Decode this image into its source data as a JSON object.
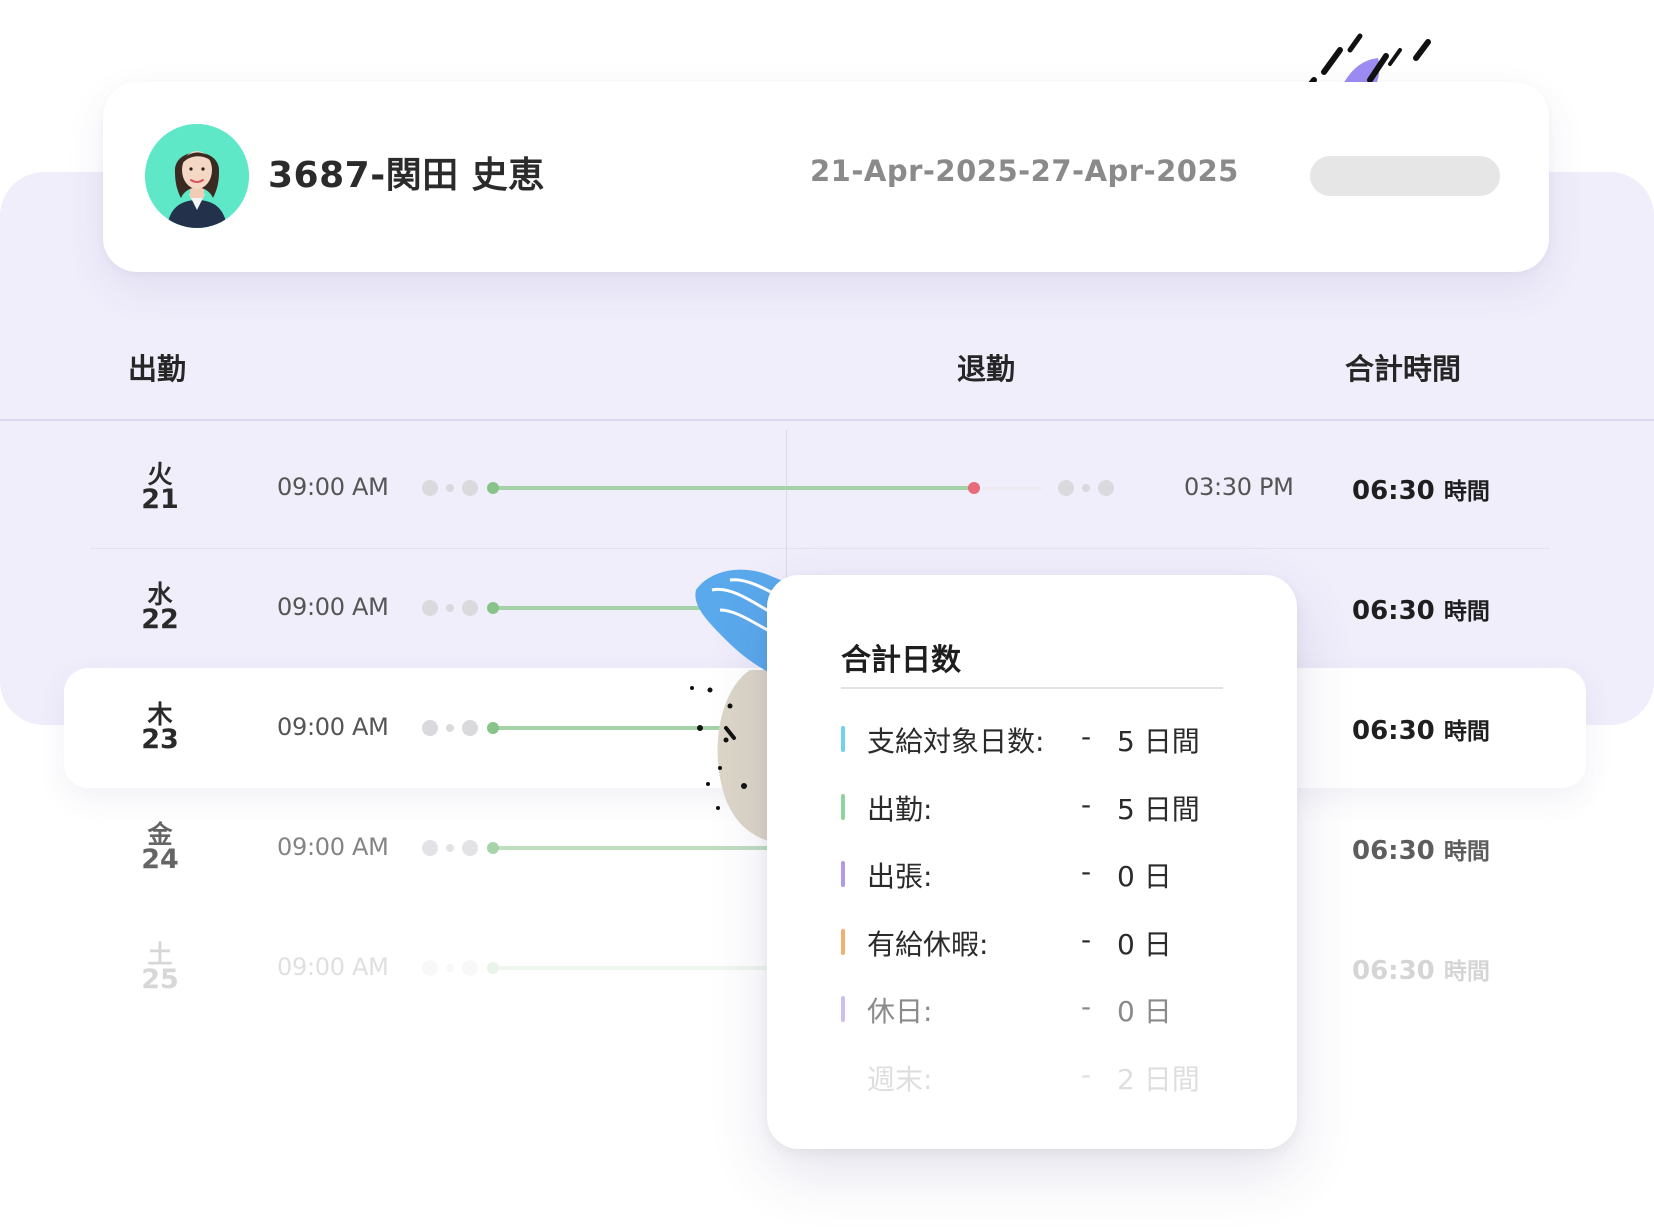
{
  "employee": {
    "name": "3687-関田 史恵",
    "date_range": "21-Apr-2025-27-Apr-2025"
  },
  "columns": {
    "clock_in": "出勤",
    "clock_out": "退勤",
    "total": "合計時間"
  },
  "rows": [
    {
      "weekday": "火",
      "day": "21",
      "in": "09:00 AM",
      "out": "03:30 PM",
      "total": "06:30",
      "unit": "時間"
    },
    {
      "weekday": "水",
      "day": "22",
      "in": "09:00 AM",
      "out": "",
      "total": "06:30",
      "unit": "時間"
    },
    {
      "weekday": "木",
      "day": "23",
      "in": "09:00 AM",
      "out": "",
      "total": "06:30",
      "unit": "時間"
    },
    {
      "weekday": "金",
      "day": "24",
      "in": "09:00 AM",
      "out": "",
      "total": "06:30",
      "unit": "時間"
    },
    {
      "weekday": "土",
      "day": "25",
      "in": "09:00 AM",
      "out": "",
      "total": "06:30",
      "unit": "時間"
    }
  ],
  "summary": {
    "title": "合計日数",
    "items": [
      {
        "label": "支給対象日数:",
        "dash": "-",
        "value": "5 日間",
        "color": "#6fd3ec"
      },
      {
        "label": "出勤:",
        "dash": "-",
        "value": "5 日間",
        "color": "#8fd49b"
      },
      {
        "label": "出張:",
        "dash": "-",
        "value": "0 日",
        "color": "#b39ae6"
      },
      {
        "label": "有給休暇:",
        "dash": "-",
        "value": "0 日",
        "color": "#f2b06e"
      },
      {
        "label": "休日:",
        "dash": "-",
        "value": "0 日",
        "color": "#a88be0"
      },
      {
        "label": "週末:",
        "dash": "-",
        "value": "2 日間",
        "color": "#ffffff"
      }
    ]
  },
  "colors": {
    "accent_purple": "#8b78f0",
    "timeline_green": "#86c48a",
    "clock_out_red": "#e96a7a",
    "avatar_bg": "#5ee8c8"
  }
}
